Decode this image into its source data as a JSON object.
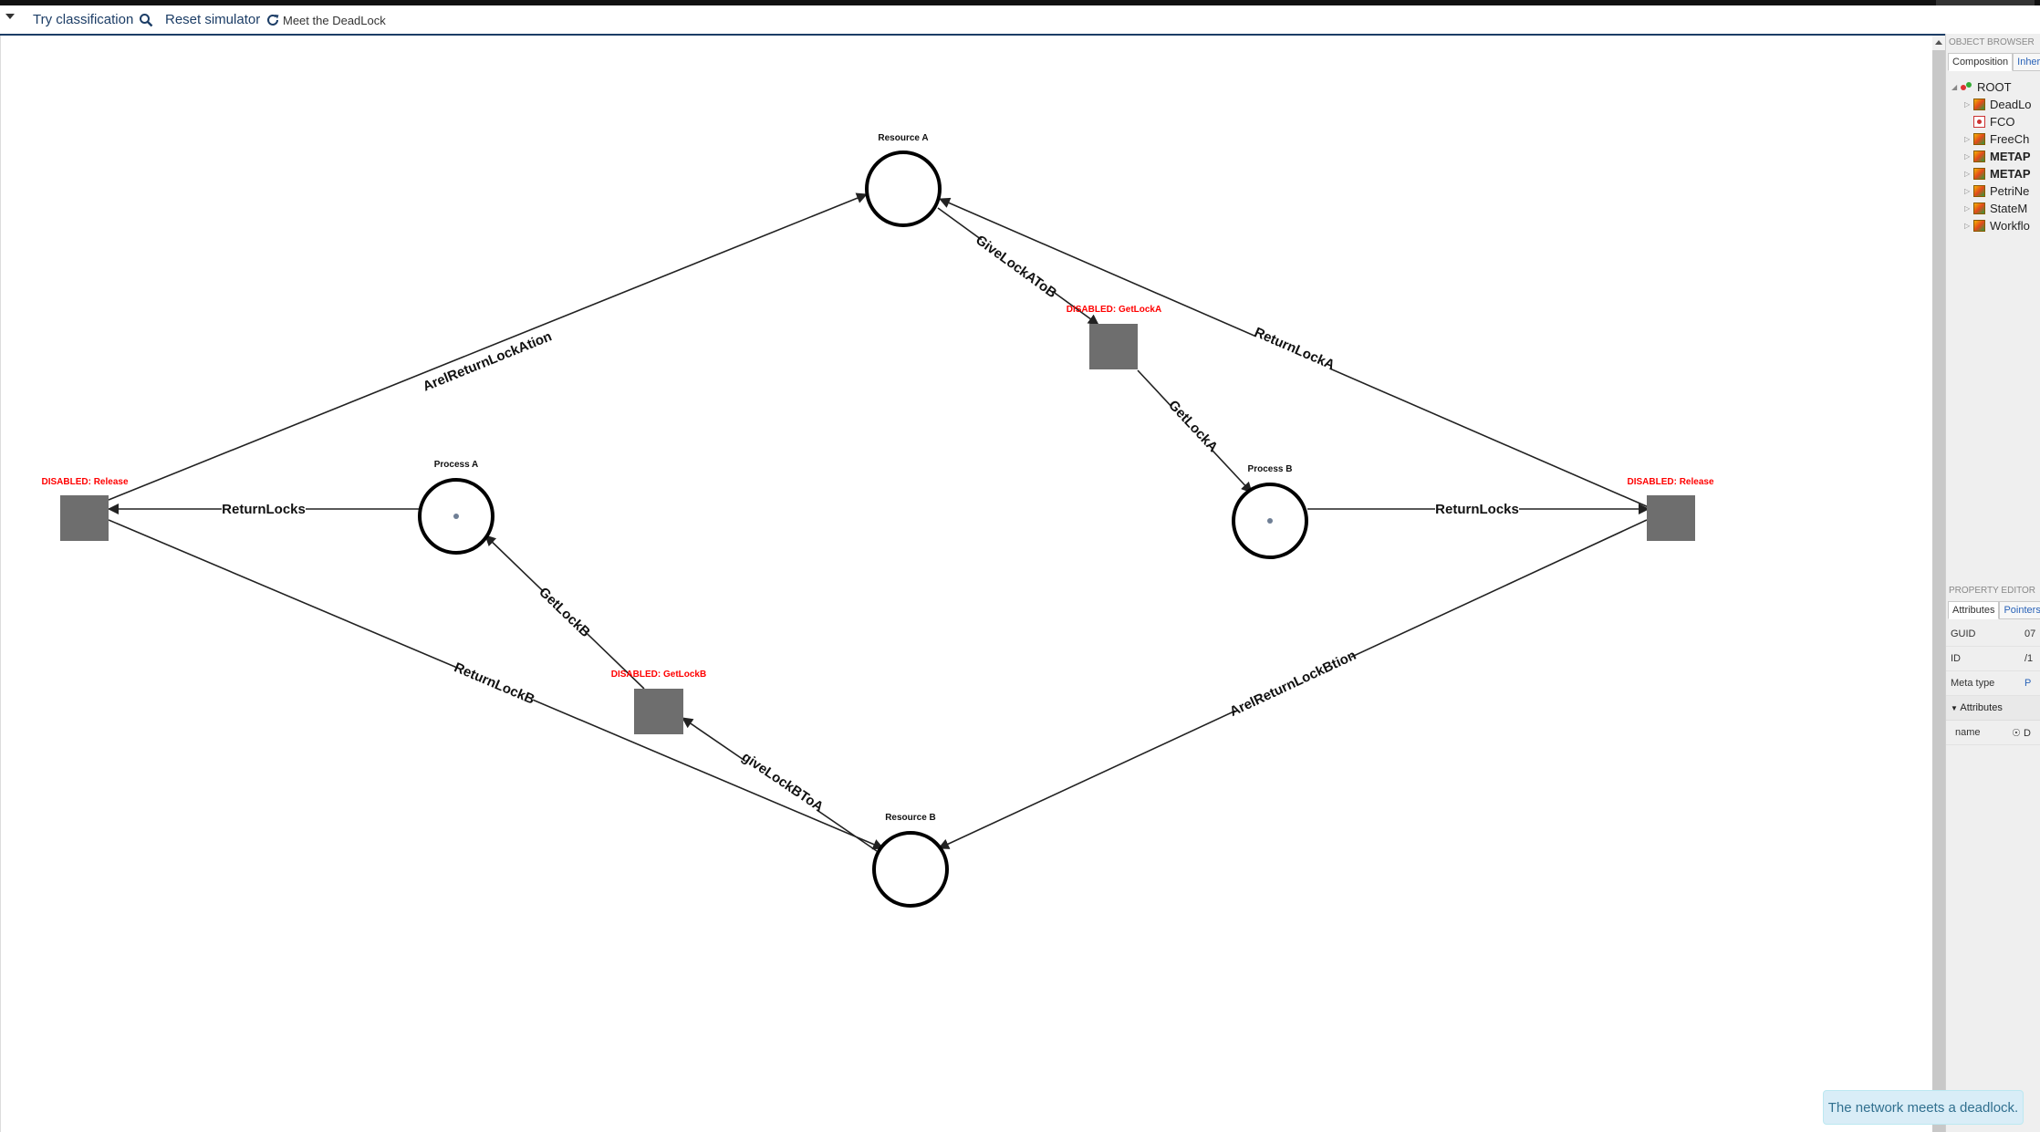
{
  "toolbar": {
    "classify_label": "Try classification",
    "reset_label": "Reset simulator",
    "model_title": "Meet the DeadLock"
  },
  "places": [
    {
      "label": "Resource A",
      "tokens": 0
    },
    {
      "label": "Process A",
      "tokens": 1
    },
    {
      "label": "Process B",
      "tokens": 1
    },
    {
      "label": "Resource B",
      "tokens": 0
    }
  ],
  "transitions": [
    {
      "label": "DISABLED: GetLockA"
    },
    {
      "label": "DISABLED: GetLockB"
    },
    {
      "label": "DISABLED: Release"
    },
    {
      "label": "DISABLED: Release"
    }
  ],
  "arcs": [
    {
      "label": "ArelReturnLockAtion"
    },
    {
      "label": "GiveLockAToB"
    },
    {
      "label": "ReturnLockA"
    },
    {
      "label": "GetLockA"
    },
    {
      "label": "ReturnLocks"
    },
    {
      "label": "ReturnLocks"
    },
    {
      "label": "GetLockB"
    },
    {
      "label": "ReturnLockB"
    },
    {
      "label": "giveLockBToA"
    },
    {
      "label": "ArelReturnLockBtion"
    }
  ],
  "object_browser": {
    "title": "OBJECT BROWSER",
    "tabs": [
      "Composition",
      "Inher"
    ],
    "items": [
      {
        "label": "ROOT",
        "icon": "root-icon"
      },
      {
        "label": "DeadLo",
        "icon": "model-icon"
      },
      {
        "label": "FCO",
        "icon": "fco-icon"
      },
      {
        "label": "FreeCh",
        "icon": "model-icon"
      },
      {
        "label": "METAP",
        "icon": "model-icon"
      },
      {
        "label": "METAP",
        "icon": "model-icon"
      },
      {
        "label": "PetriNe",
        "icon": "model-icon"
      },
      {
        "label": "StateM",
        "icon": "model-icon"
      },
      {
        "label": "Workflo",
        "icon": "model-icon"
      }
    ]
  },
  "property_editor": {
    "title": "PROPERTY EDITOR",
    "tabs": [
      "Attributes",
      "Pointers"
    ],
    "rows": [
      {
        "key": "GUID",
        "value": "07"
      },
      {
        "key": "ID",
        "value": "/1"
      },
      {
        "key": "Meta type",
        "value": "P"
      }
    ],
    "group_label": "Attributes",
    "name_key": "name",
    "name_value": "D"
  },
  "notification": "The network meets a deadlock.",
  "colors": {
    "accent": "#1c3d66",
    "disabled_label": "#ff0000",
    "transition_fill": "#6e6e6e",
    "toast_bg": "#d9edf7",
    "toast_text": "#31708f"
  }
}
